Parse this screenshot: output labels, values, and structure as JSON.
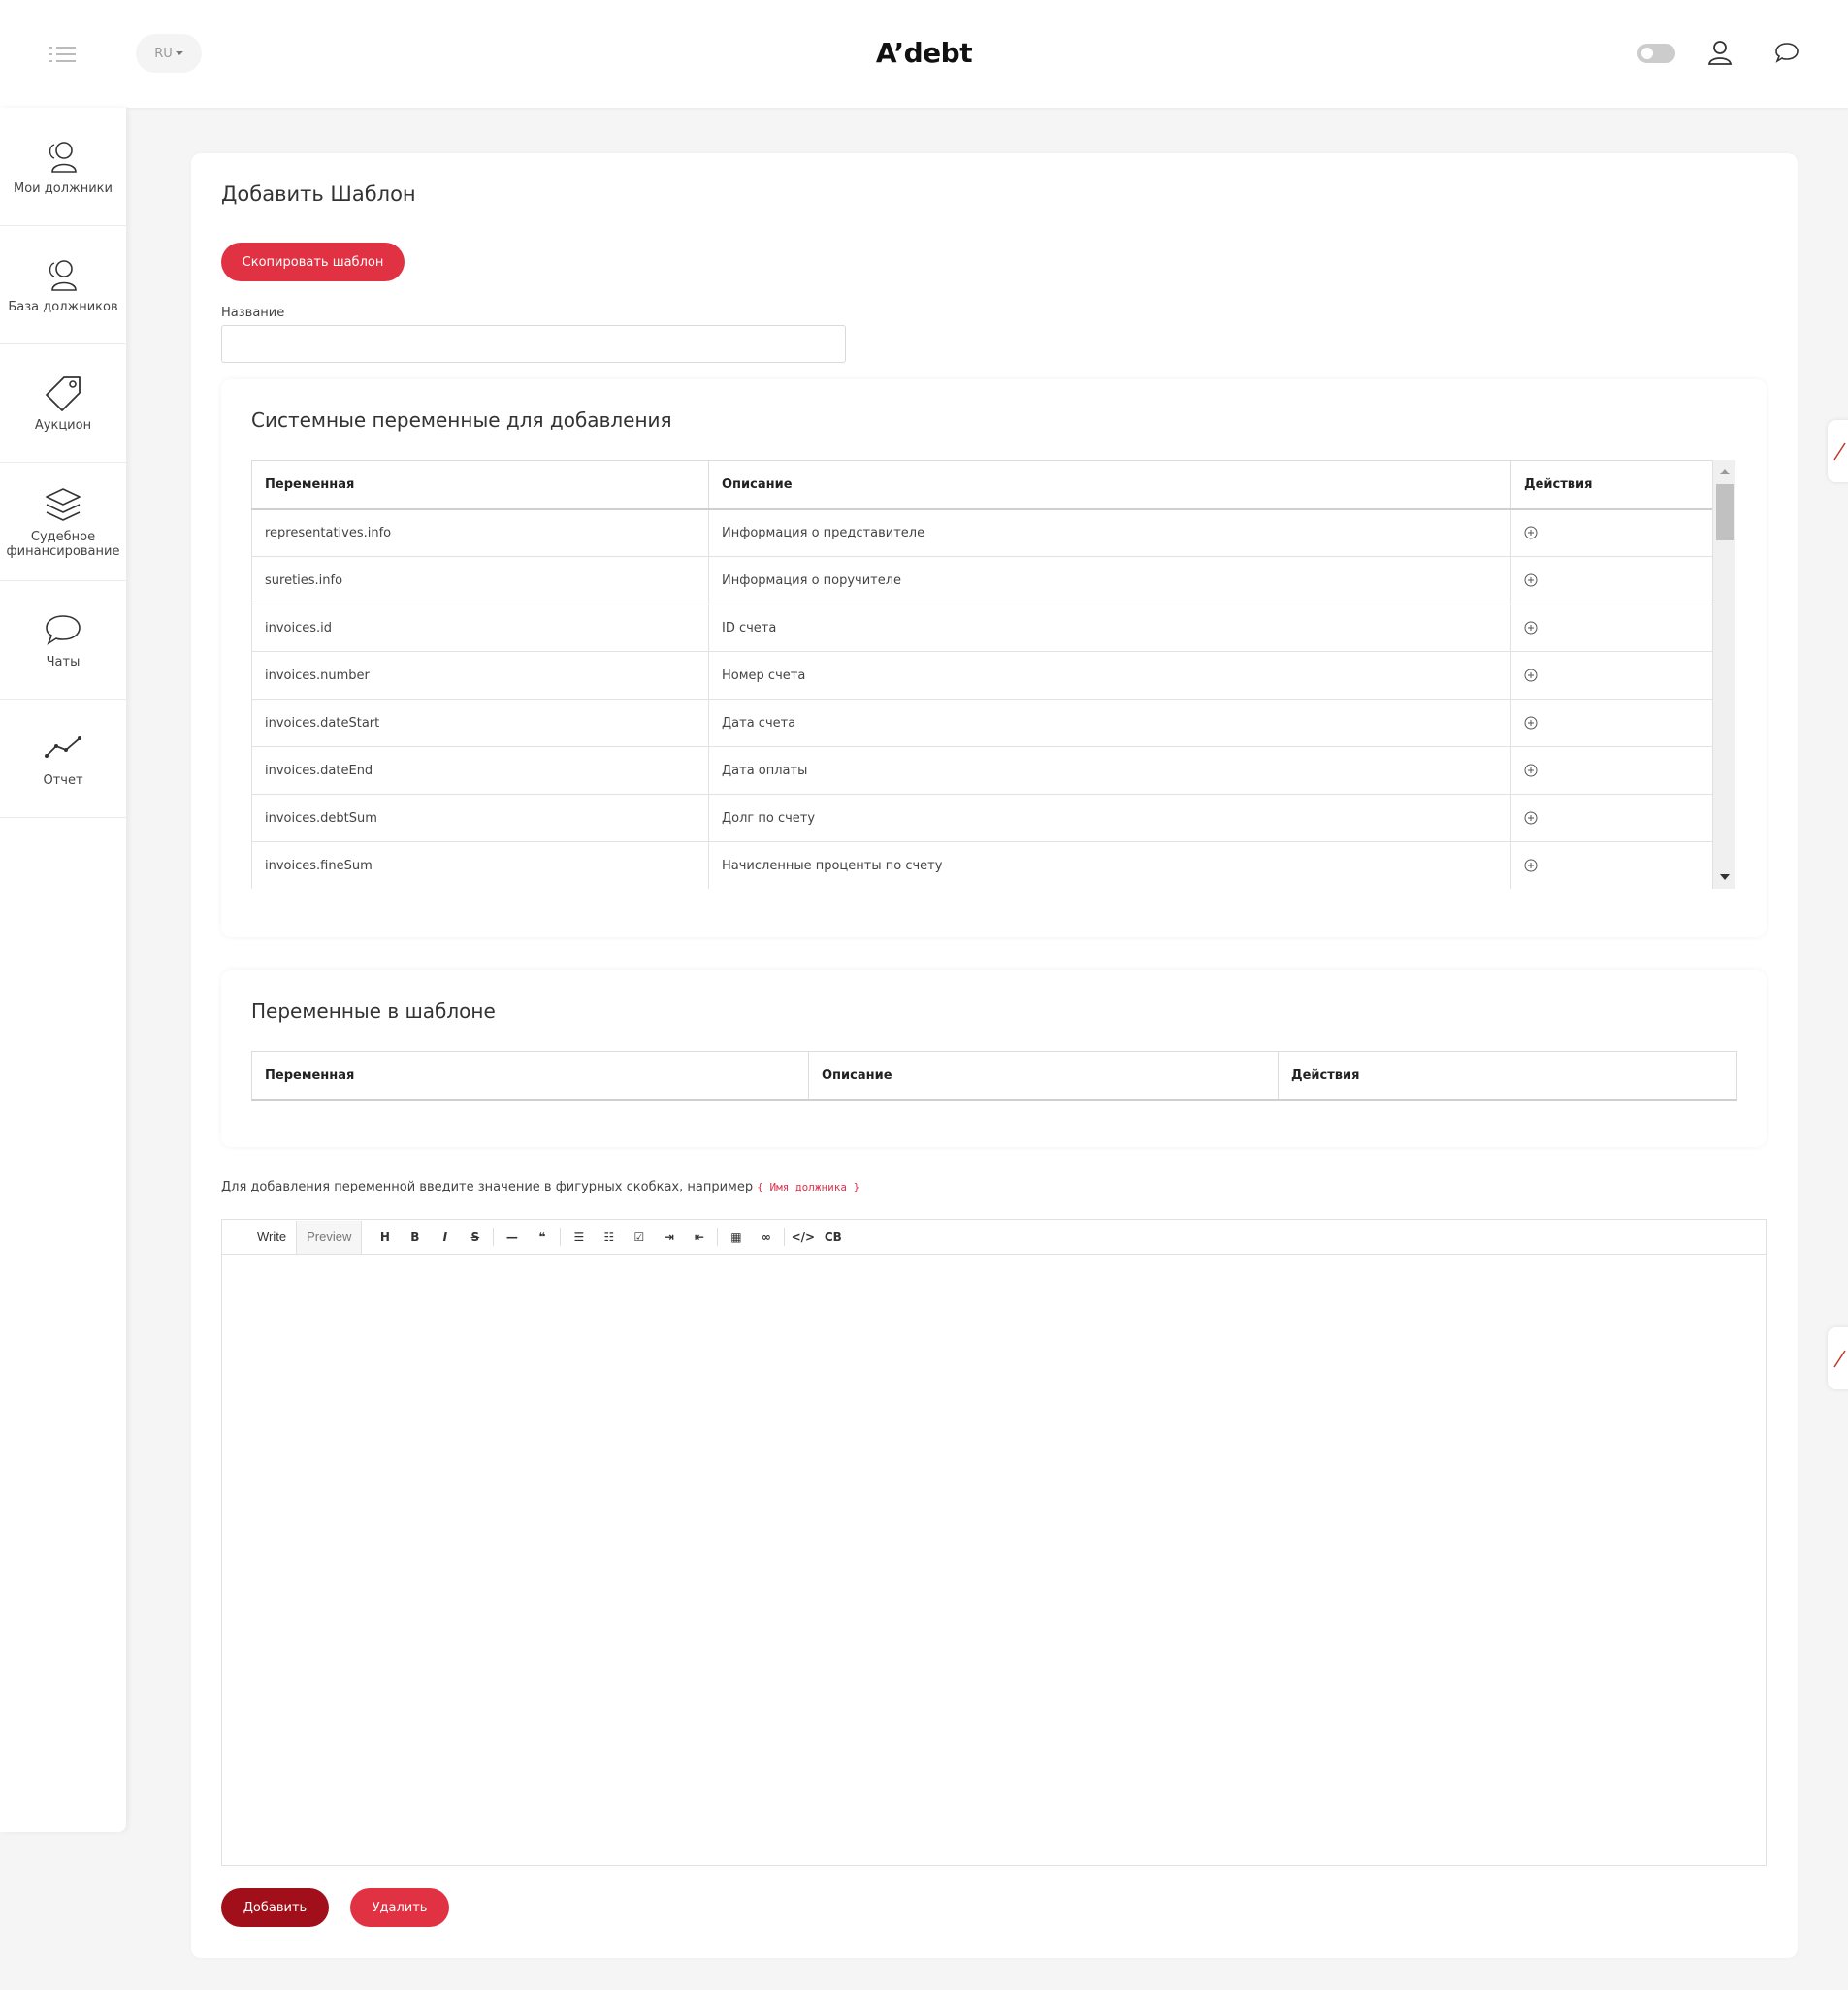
{
  "header": {
    "lang": "RU",
    "logo": "A’debt"
  },
  "sidebar": {
    "items": [
      {
        "label": "Мои должники",
        "icon": "users-icon"
      },
      {
        "label": "База должников",
        "icon": "users-icon"
      },
      {
        "label": "Аукцион",
        "icon": "tag-icon"
      },
      {
        "label": "Судебное финансирование",
        "icon": "layers-icon"
      },
      {
        "label": "Чаты",
        "icon": "chat-icon"
      },
      {
        "label": "Отчет",
        "icon": "chart-line-icon"
      }
    ]
  },
  "page": {
    "title": "Добавить Шаблон",
    "copy_button": "Скопировать шаблон",
    "name_label": "Название",
    "name_value": ""
  },
  "system_vars": {
    "title": "Системные переменные для добавления",
    "columns": [
      "Переменная",
      "Описание",
      "Действия"
    ],
    "rows": [
      {
        "var": "representatives.info",
        "desc": "Информация о представителе"
      },
      {
        "var": "sureties.info",
        "desc": "Информация о поручителе"
      },
      {
        "var": "invoices.id",
        "desc": "ID счета"
      },
      {
        "var": "invoices.number",
        "desc": "Номер счета"
      },
      {
        "var": "invoices.dateStart",
        "desc": "Дата счета"
      },
      {
        "var": "invoices.dateEnd",
        "desc": "Дата оплаты"
      },
      {
        "var": "invoices.debtSum",
        "desc": "Долг по счету"
      },
      {
        "var": "invoices.fineSum",
        "desc": "Начисленные проценты по счету"
      }
    ]
  },
  "template_vars": {
    "title": "Переменные в шаблоне",
    "columns": [
      "Переменная",
      "Описание",
      "Действия"
    ]
  },
  "editor": {
    "hint": "Для добавления переменной введите значение в фигурных скобках, например",
    "hint_code": "{ Имя должника }",
    "tab_write": "Write",
    "tab_preview": "Preview",
    "tools": [
      {
        "name": "heading-button",
        "glyph": "H"
      },
      {
        "name": "bold-button",
        "glyph": "B"
      },
      {
        "name": "italic-button",
        "glyph": "I"
      },
      {
        "name": "strikethrough-button",
        "glyph": "S"
      },
      {
        "name": "horizontal-rule-button",
        "glyph": "—"
      },
      {
        "name": "quote-button",
        "glyph": "❝"
      },
      {
        "name": "bullet-list-button",
        "glyph": "☰"
      },
      {
        "name": "numbered-list-button",
        "glyph": "☷"
      },
      {
        "name": "checklist-button",
        "glyph": "☑"
      },
      {
        "name": "indent-button",
        "glyph": "⇥"
      },
      {
        "name": "outdent-button",
        "glyph": "⇤"
      },
      {
        "name": "table-button",
        "glyph": "▦"
      },
      {
        "name": "link-button",
        "glyph": "∞"
      },
      {
        "name": "code-button",
        "glyph": "</>"
      },
      {
        "name": "code-block-button",
        "glyph": "CB"
      }
    ]
  },
  "actions": {
    "add": "Добавить",
    "delete": "Удалить"
  },
  "colors": {
    "primary": "#e03243",
    "dark_primary": "#a00f1a"
  }
}
